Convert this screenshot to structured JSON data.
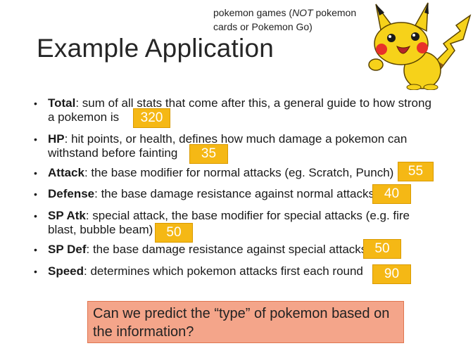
{
  "note": {
    "prefix": "pokemon games (",
    "emph": "NOT",
    "suffix": " pokemon cards or Pokemon Go)"
  },
  "title": "Example Application",
  "bullets": [
    {
      "term": "Total",
      "line1": ": sum of all stats that come after this, a general guide to how strong",
      "line2": "a pokemon is",
      "value": "320"
    },
    {
      "term": "HP",
      "line1": ": hit points, or health, defines how much damage a pokemon can",
      "line2": "withstand before fainting",
      "value": "35"
    },
    {
      "term": "Attack",
      "line1": ": the base modifier for normal attacks (eg. Scratch, Punch)",
      "line2": "",
      "value": "55"
    },
    {
      "term": "Defense",
      "line1": ": the base damage resistance against normal attacks",
      "line2": "",
      "value": "40"
    },
    {
      "term": "SP Atk",
      "line1": ": special attack, the base modifier for special attacks (e.g. fire",
      "line2": "blast, bubble beam)",
      "value": "50"
    },
    {
      "term": "SP Def",
      "line1": ": the base damage resistance against special attacks",
      "line2": "",
      "value": "50"
    },
    {
      "term": "Speed",
      "line1": ": determines which pokemon attacks first each round",
      "line2": "",
      "value": "90"
    }
  ],
  "question": "Can we predict the “type” of pokemon based on the information?",
  "colors": {
    "value_box": "#f5b815",
    "question_box": "#f4a58a"
  },
  "image": {
    "icon": "pikachu-image"
  }
}
